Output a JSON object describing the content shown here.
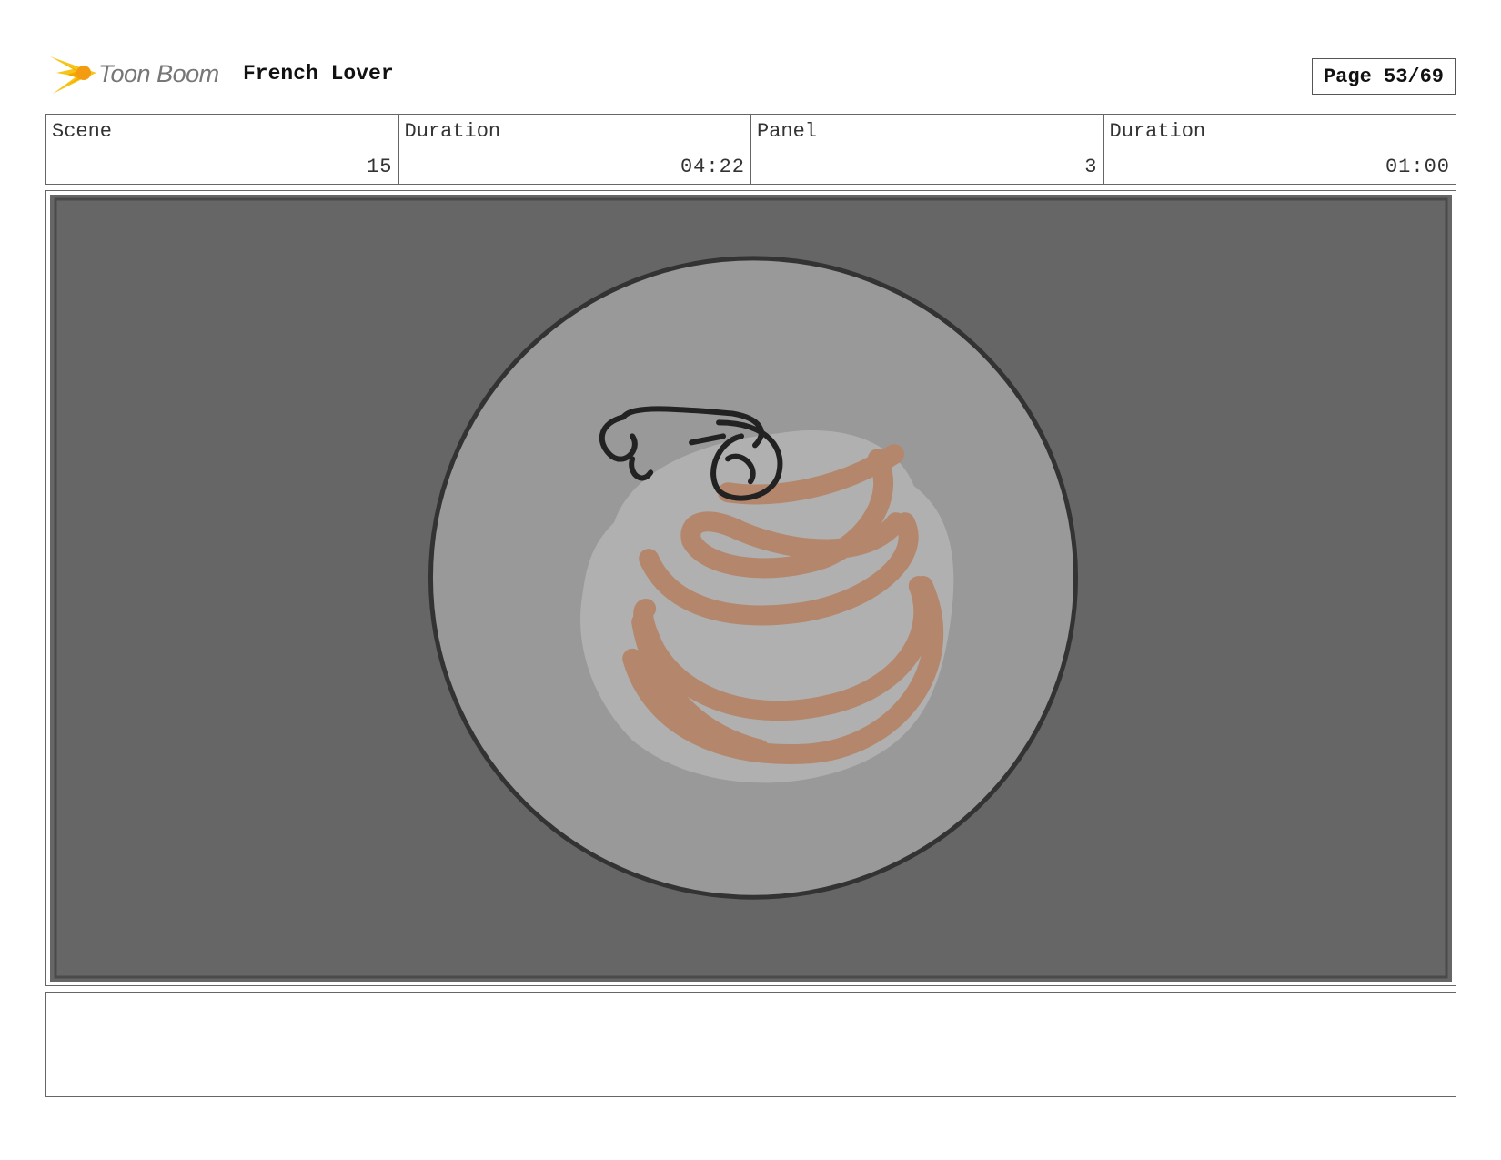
{
  "header": {
    "logo_text": "Toon Boom",
    "project_title": "French Lover",
    "page_label": "Page 53/69"
  },
  "info": {
    "scene_label": "Scene",
    "scene_value": "15",
    "scene_duration_label": "Duration",
    "scene_duration_value": "04:22",
    "panel_label": "Panel",
    "panel_value": "3",
    "panel_duration_label": "Duration",
    "panel_duration_value": "01:00"
  },
  "panel": {
    "background_color": "#666666",
    "plate_color": "#999999",
    "food_color": "#b0b0b0",
    "stroke_color": "#b4876c"
  },
  "notes": {
    "text": ""
  }
}
